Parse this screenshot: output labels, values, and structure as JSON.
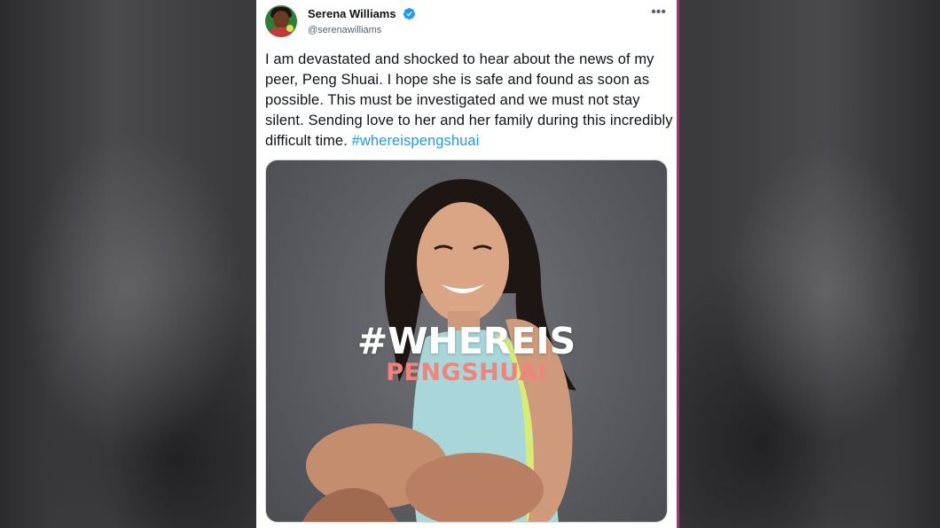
{
  "tweet": {
    "author": {
      "display_name": "Serena Williams",
      "handle": "@serenawilliams",
      "verified": true
    },
    "more_icon": "more-horizontal-icon",
    "text": "I am devastated and shocked to hear about the news of my peer, Peng Shuai. I hope she is safe and found as soon as possible. This must be investigated and we must not stay silent. Sending love to her and her family during this incredibly difficult time. ",
    "hashtag": "#whereispengshuai",
    "media": {
      "overlay_line1": "#WHEREIS",
      "overlay_line2": "PENGSHUAI"
    }
  },
  "colors": {
    "accent": "#1d9bf0",
    "overlay_line2": "#f0837a",
    "frame_border": "#b9287c"
  }
}
